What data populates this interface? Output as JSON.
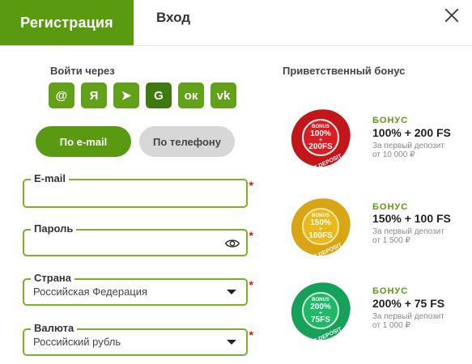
{
  "tabs": {
    "register": "Регистрация",
    "login": "Вход"
  },
  "social": {
    "title": "Войти через",
    "items": [
      {
        "icon": "at-icon",
        "glyph": "@"
      },
      {
        "icon": "yandex-icon",
        "glyph": "Я"
      },
      {
        "icon": "telegram-icon",
        "glyph": "➤"
      },
      {
        "icon": "google-icon",
        "glyph": "G"
      },
      {
        "icon": "odnoklassniki-icon",
        "glyph": "ок"
      },
      {
        "icon": "vk-icon",
        "glyph": "vk"
      }
    ]
  },
  "method": {
    "email": "По e-mail",
    "phone": "По телефону"
  },
  "form": {
    "email_label": "E-mail",
    "email_value": "",
    "password_label": "Пароль",
    "password_value": "",
    "country_label": "Страна",
    "country_value": "Российская Федерация",
    "currency_label": "Валюта",
    "currency_value": "Российский рубль",
    "required_mark": "*"
  },
  "bonus": {
    "title": "Приветственный бонус",
    "items": [
      {
        "head": "БОНУС",
        "main": "100% + 200 FS",
        "sub1": "За первый депозит",
        "sub2": "от 10 000 ₽",
        "badge_line1": "BONUS",
        "badge_line2": "100%",
        "badge_line3": "+",
        "badge_line4": "200FS",
        "badge_ribbon": "FIRST DEPOSIT",
        "color": "#c2161b"
      },
      {
        "head": "БОНУС",
        "main": "150% + 100 FS",
        "sub1": "За первый депозит",
        "sub2": "от 1 500 ₽",
        "badge_line1": "BONUS",
        "badge_line2": "150%",
        "badge_line3": "+",
        "badge_line4": "100FS",
        "badge_ribbon": "FIRST DEPOSIT",
        "color": "#d9a514"
      },
      {
        "head": "БОНУС",
        "main": "200% + 75 FS",
        "sub1": "За первый депозит",
        "sub2": "от 1 000 ₽",
        "badge_line1": "BONUS",
        "badge_line2": "200%",
        "badge_line3": "+",
        "badge_line4": "75FS",
        "badge_ribbon": "FIRST DEPOSIT",
        "color": "#17a05a"
      }
    ]
  }
}
